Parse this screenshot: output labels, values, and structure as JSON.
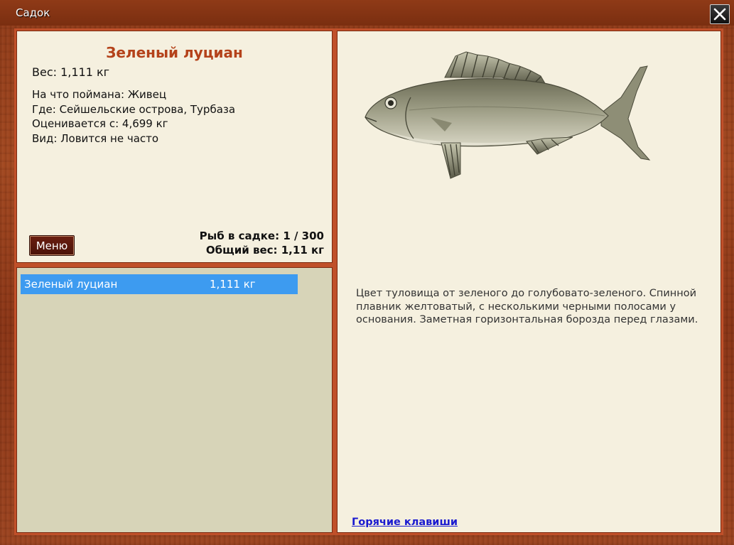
{
  "window": {
    "title": "Садок",
    "close_icon": "close-icon"
  },
  "info": {
    "fish_name": "Зеленый луциан",
    "weight_line": "Вес: 1,111 кг",
    "caught_on": "На что поймана: Живец",
    "location": "Где: Сейшельские острова, Турбаза",
    "valued_from": "Оценивается с: 4,699 кг",
    "rarity": "Вид: Ловится не часто",
    "menu_label": "Меню",
    "fish_in_keepnet": "Рыб в садке: 1 / 300",
    "total_weight": "Общий вес: 1,11 кг"
  },
  "list": {
    "items": [
      {
        "name": "Зеленый луциан",
        "weight": "1,111 кг",
        "selected": true
      }
    ]
  },
  "details": {
    "description": "Цвет туловища от зеленого до голубовато-зеленого. Спинной плавник желтоватый, с несколькими черными полосами у основания. Заметная горизонтальная борозда перед глазами.",
    "hotkeys_link": "Горячие клавиши"
  },
  "colors": {
    "wood_frame": "#9c4420",
    "panel_border": "#c0502a",
    "panel_bg": "#f5f0df",
    "list_bg": "#d7d4b8",
    "selection": "#3d9bf0",
    "fish_name": "#b4421a",
    "link": "#1a1ad0"
  }
}
